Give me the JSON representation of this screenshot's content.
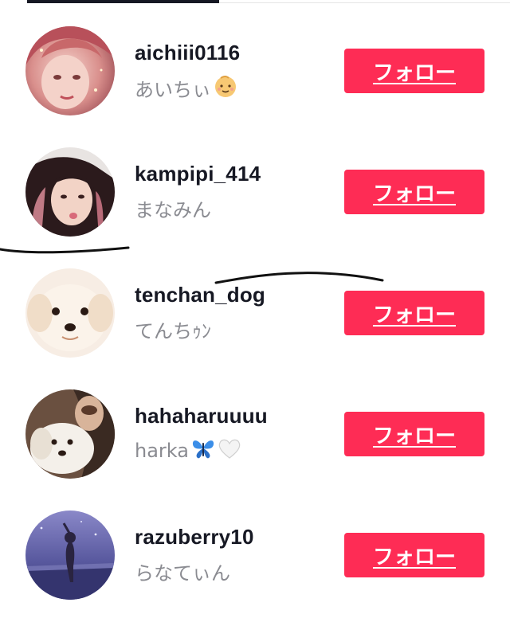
{
  "colors": {
    "accent": "#fe2c55",
    "username": "#161823",
    "nickname": "#8a8b91"
  },
  "users": [
    {
      "username": "aichiii0116",
      "nickname": "あいちぃ",
      "emoji": [
        "baby-face-icon"
      ],
      "follow_label": "フォロー"
    },
    {
      "username": "kampipi_414",
      "nickname": "まなみん",
      "emoji": [],
      "follow_label": "フォロー"
    },
    {
      "username": "tenchan_dog",
      "nickname": "てんちｩﾝ",
      "emoji": [],
      "follow_label": "フォロー"
    },
    {
      "username": "hahaharuuuu",
      "nickname": "harka",
      "emoji": [
        "blue-butterfly-icon",
        "white-heart-icon"
      ],
      "follow_label": "フォロー"
    },
    {
      "username": "razuberry10",
      "nickname": "らなてぃん",
      "emoji": [],
      "follow_label": "フォロー"
    }
  ]
}
